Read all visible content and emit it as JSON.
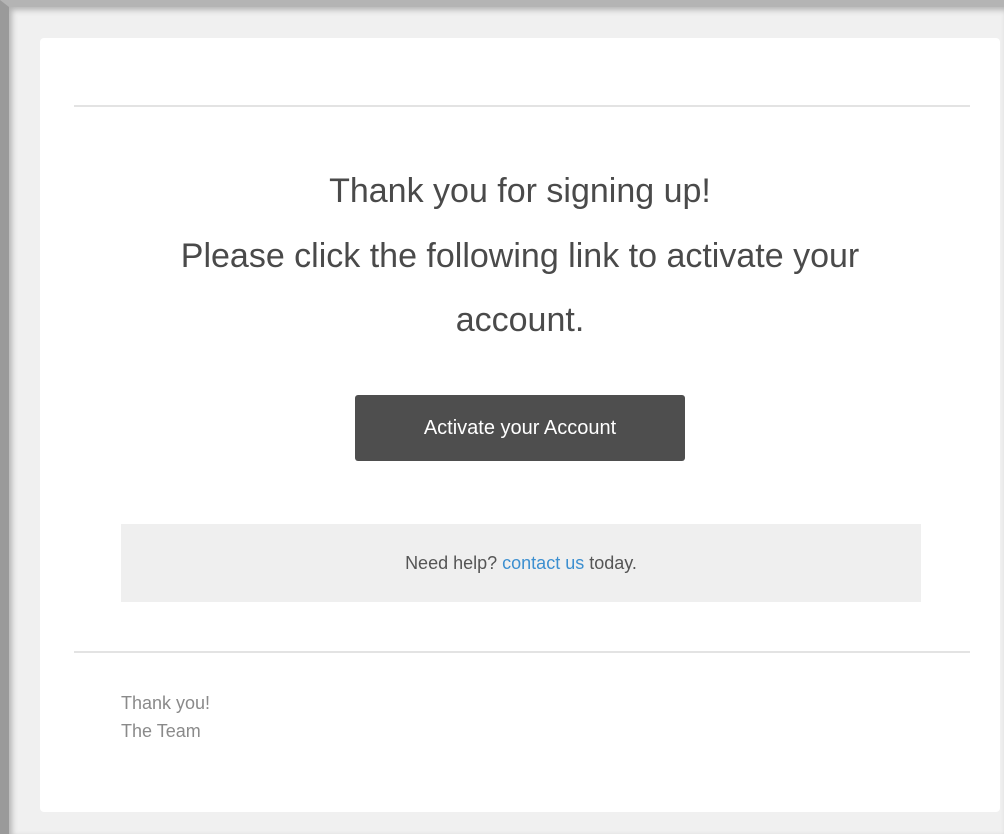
{
  "email": {
    "heading": "Thank you for signing up!",
    "instruction": "Please click the following link to activate your account.",
    "button_label": "Activate your Account",
    "help": {
      "prefix": "Need help?",
      "link_text": "contact us",
      "suffix": "today."
    },
    "signoff": {
      "line1": "Thank you!",
      "line2": "The Team"
    }
  },
  "colors": {
    "button_bg": "#4e4e4e",
    "link": "#3c8fd0",
    "help_bg": "#efefef",
    "page_bg": "#f0f0f0"
  }
}
